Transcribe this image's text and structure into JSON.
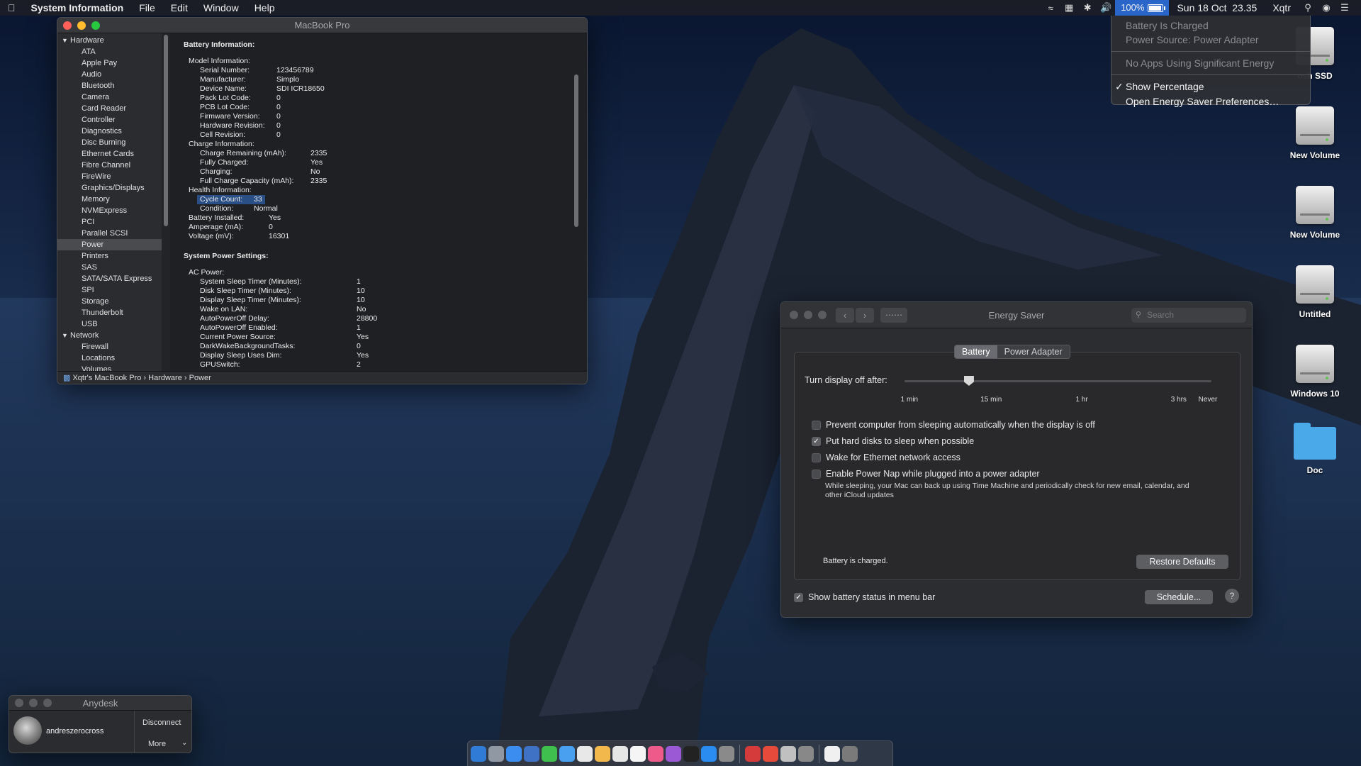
{
  "menubar": {
    "app_name": "System Information",
    "menus": [
      "File",
      "Edit",
      "Window",
      "Help"
    ],
    "battery_percent": "100%",
    "battery_level": 1.0,
    "datetime": "Sun 18 Oct  23.35",
    "user": "Xqtr"
  },
  "battery_menu": {
    "status": "Battery Is Charged",
    "source": "Power Source: Power Adapter",
    "apps": "No Apps Using Significant Energy",
    "show_percentage": "Show Percentage",
    "open_prefs": "Open Energy Saver Preferences…"
  },
  "sysinfo": {
    "title": "MacBook Pro",
    "sidebar": {
      "hardware_label": "Hardware",
      "hardware_items": [
        "ATA",
        "Apple Pay",
        "Audio",
        "Bluetooth",
        "Camera",
        "Card Reader",
        "Controller",
        "Diagnostics",
        "Disc Burning",
        "Ethernet Cards",
        "Fibre Channel",
        "FireWire",
        "Graphics/Displays",
        "Memory",
        "NVMExpress",
        "PCI",
        "Parallel SCSI",
        "Power",
        "Printers",
        "SAS",
        "SATA/SATA Express",
        "SPI",
        "Storage",
        "Thunderbolt",
        "USB"
      ],
      "selected": "Power",
      "network_label": "Network",
      "network_items": [
        "Firewall",
        "Locations",
        "Volumes"
      ]
    },
    "battery_title": "Battery Information:",
    "battery_rows": [
      {
        "k": "Model Information:",
        "v": "",
        "indent": 0,
        "w": 0
      },
      {
        "k": "Serial Number:",
        "v": "123456789",
        "indent": 1,
        "w": 108
      },
      {
        "k": "Manufacturer:",
        "v": "Simplo",
        "indent": 1,
        "w": 108
      },
      {
        "k": "Device Name:",
        "v": "SDI ICR18650",
        "indent": 1,
        "w": 108
      },
      {
        "k": "Pack Lot Code:",
        "v": "0",
        "indent": 1,
        "w": 108
      },
      {
        "k": "PCB Lot Code:",
        "v": "0",
        "indent": 1,
        "w": 108
      },
      {
        "k": "Firmware Version:",
        "v": "0",
        "indent": 1,
        "w": 108
      },
      {
        "k": "Hardware Revision:",
        "v": "0",
        "indent": 1,
        "w": 108
      },
      {
        "k": "Cell Revision:",
        "v": "0",
        "indent": 1,
        "w": 108
      },
      {
        "k": "Charge Information:",
        "v": "",
        "indent": 0,
        "w": 0
      },
      {
        "k": "Charge Remaining (mAh):",
        "v": "2335",
        "indent": 1,
        "w": 156
      },
      {
        "k": "Fully Charged:",
        "v": "Yes",
        "indent": 1,
        "w": 156
      },
      {
        "k": "Charging:",
        "v": "No",
        "indent": 1,
        "w": 156
      },
      {
        "k": "Full Charge Capacity (mAh):",
        "v": "2335",
        "indent": 1,
        "w": 156
      },
      {
        "k": "Health Information:",
        "v": "",
        "indent": 0,
        "w": 0
      },
      {
        "k": "Cycle Count:",
        "v": "33",
        "indent": 1,
        "w": 76,
        "hl": true
      },
      {
        "k": "Condition:",
        "v": "Normal",
        "indent": 1,
        "w": 76
      },
      {
        "k": "Battery Installed:",
        "v": "Yes",
        "indent": 0,
        "w": 113
      },
      {
        "k": "Amperage (mA):",
        "v": "0",
        "indent": 0,
        "w": 113
      },
      {
        "k": "Voltage (mV):",
        "v": "16301",
        "indent": 0,
        "w": 113
      }
    ],
    "power_title": "System Power Settings:",
    "power_rows": [
      {
        "k": "AC Power:",
        "v": "",
        "indent": 0,
        "w": 0
      },
      {
        "k": "System Sleep Timer (Minutes):",
        "v": "1",
        "indent": 1,
        "w": 221
      },
      {
        "k": "Disk Sleep Timer (Minutes):",
        "v": "10",
        "indent": 1,
        "w": 221
      },
      {
        "k": "Display Sleep Timer (Minutes):",
        "v": "10",
        "indent": 1,
        "w": 221
      },
      {
        "k": "Wake on LAN:",
        "v": "No",
        "indent": 1,
        "w": 221
      },
      {
        "k": "AutoPowerOff Delay:",
        "v": "28800",
        "indent": 1,
        "w": 221
      },
      {
        "k": "AutoPowerOff Enabled:",
        "v": "1",
        "indent": 1,
        "w": 221
      },
      {
        "k": "Current Power Source:",
        "v": "Yes",
        "indent": 1,
        "w": 221
      },
      {
        "k": "DarkWakeBackgroundTasks:",
        "v": "0",
        "indent": 1,
        "w": 221
      },
      {
        "k": "Display Sleep Uses Dim:",
        "v": "Yes",
        "indent": 1,
        "w": 221
      },
      {
        "k": "GPUSwitch:",
        "v": "2",
        "indent": 1,
        "w": 221
      }
    ],
    "path": [
      "Xqtr's MacBook Pro",
      "Hardware",
      "Power"
    ]
  },
  "energy": {
    "title": "Energy Saver",
    "search_placeholder": "Search",
    "tab_battery": "Battery",
    "tab_power": "Power Adapter",
    "display_off_label": "Turn display off after:",
    "slider_value_fraction": 0.21,
    "ticks": [
      {
        "label": "1 min",
        "pos": 0.02
      },
      {
        "label": "15 min",
        "pos": 0.28
      },
      {
        "label": "1 hr",
        "pos": 0.59
      },
      {
        "label": "3 hrs",
        "pos": 0.9
      },
      {
        "label": "Never",
        "pos": 0.99
      }
    ],
    "options": [
      {
        "label": "Prevent computer from sleeping automatically when the display is off",
        "checked": false
      },
      {
        "label": "Put hard disks to sleep when possible",
        "checked": true
      },
      {
        "label": "Wake for Ethernet network access",
        "checked": false
      },
      {
        "label": "Enable Power Nap while plugged into a power adapter",
        "checked": false
      }
    ],
    "power_nap_desc": "While sleeping, your Mac can back up using Time Machine and periodically check for new email, calendar, and other iCloud updates",
    "status": "Battery is charged.",
    "restore_label": "Restore Defaults",
    "show_status_label": "Show battery status in menu bar",
    "schedule_label": "Schedule...",
    "help_label": "?"
  },
  "desktop": {
    "icons": [
      {
        "label": "osh SSD",
        "kind": "disk"
      },
      {
        "label": "New Volume",
        "kind": "disk"
      },
      {
        "label": "New Volume",
        "kind": "disk"
      },
      {
        "label": "Untitled",
        "kind": "disk"
      },
      {
        "label": "Windows 10",
        "kind": "disk"
      },
      {
        "label": "Doc",
        "kind": "folder"
      }
    ]
  },
  "anydesk": {
    "title": "Anydesk",
    "user": "andreszerocross",
    "disconnect": "Disconnect",
    "more": "More"
  },
  "dock": {
    "colors": [
      "#2f7bd6",
      "#8f98a3",
      "#3b8df0",
      "#3f71c4",
      "#3fbf4e",
      "#4aa0f0",
      "#e8e8e8",
      "#f2b84b",
      "#e6e6e6",
      "#f5f5f5",
      "#ee5a8a",
      "#9b59d6",
      "#222222",
      "#2a8cf0",
      "#8a8a8a",
      "#d63b3b",
      "#e64a3a",
      "#c0c0c0",
      "#888888",
      "#f0f0f0",
      "#7a7a7a"
    ]
  }
}
